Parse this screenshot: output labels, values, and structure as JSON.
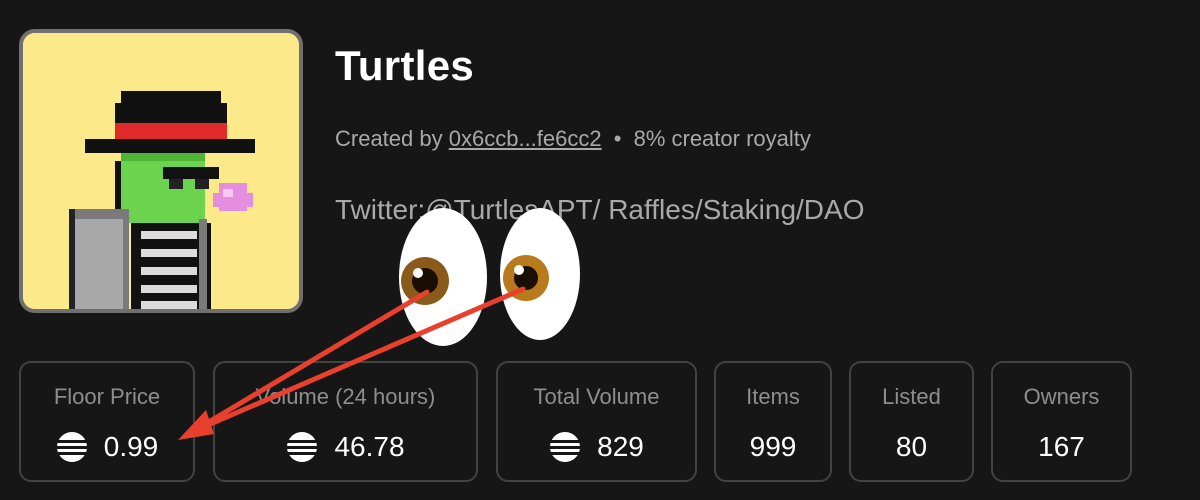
{
  "collection": {
    "name": "Turtles",
    "created_by_label": "Created by",
    "creator_address": "0x6ccb...fe6cc2",
    "separator": "•",
    "royalty": "8% creator royalty",
    "bio": "Twitter:@TurtlesAPT/ Raffles/Staking/DAO"
  },
  "stats": [
    {
      "label": "Floor Price",
      "value": "0.99",
      "icon": "aptos-coin-icon"
    },
    {
      "label": "Volume (24 hours)",
      "value": "46.78",
      "icon": "aptos-coin-icon"
    },
    {
      "label": "Total Volume",
      "value": "829",
      "icon": "aptos-coin-icon"
    },
    {
      "label": "Items",
      "value": "999"
    },
    {
      "label": "Listed",
      "value": "80"
    },
    {
      "label": "Owners",
      "value": "167"
    }
  ],
  "annotations": {
    "emoji": "eyes-emoji",
    "arrow_color": "#e8402c"
  },
  "colors": {
    "background": "#161616",
    "avatar_background": "#fbe98a",
    "card_border": "#434343",
    "muted_text": "#a9a9a9"
  }
}
